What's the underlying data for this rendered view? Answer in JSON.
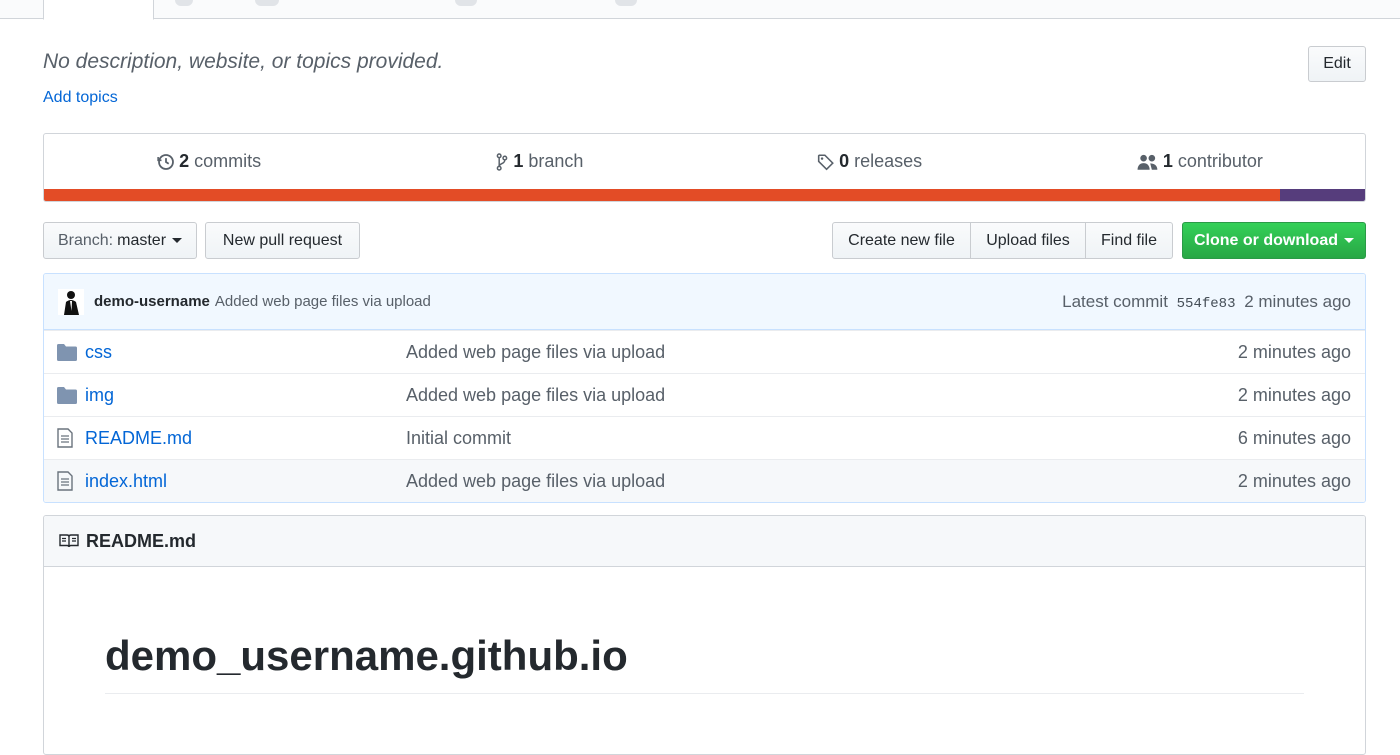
{
  "repo": {
    "description": "No description, website, or topics provided.",
    "add_topics_label": "Add topics",
    "edit_label": "Edit"
  },
  "summary": {
    "commits_count": "2",
    "commits_label": "commits",
    "branch_count": "1",
    "branch_label": "branch",
    "releases_count": "0",
    "releases_label": "releases",
    "contributor_count": "1",
    "contributor_label": "contributor"
  },
  "colors": {
    "lang_primary": "#e34c26",
    "lang_secondary": "#563d7c",
    "link": "#0366d6",
    "green": "#28a745"
  },
  "toolbar": {
    "branch_prefix": "Branch:",
    "branch_name": "master",
    "new_pr_label": "New pull request",
    "create_file_label": "Create new file",
    "upload_files_label": "Upload files",
    "find_file_label": "Find file",
    "clone_label": "Clone or download"
  },
  "latest_commit": {
    "author": "demo-username",
    "message": "Added web page files via upload",
    "prefix": "Latest commit",
    "sha": "554fe83",
    "age": "2 minutes ago"
  },
  "files": [
    {
      "name": "css",
      "type": "folder",
      "icon": "folder-icon",
      "message": "Added web page files via upload",
      "age": "2 minutes ago"
    },
    {
      "name": "img",
      "type": "folder",
      "icon": "folder-icon",
      "message": "Added web page files via upload",
      "age": "2 minutes ago"
    },
    {
      "name": "README.md",
      "type": "file",
      "icon": "file-icon",
      "message": "Initial commit",
      "age": "6 minutes ago"
    },
    {
      "name": "index.html",
      "type": "file",
      "icon": "file-icon",
      "message": "Added web page files via upload",
      "age": "2 minutes ago"
    }
  ],
  "readme": {
    "title": "README.md",
    "heading": "demo_username.github.io"
  }
}
